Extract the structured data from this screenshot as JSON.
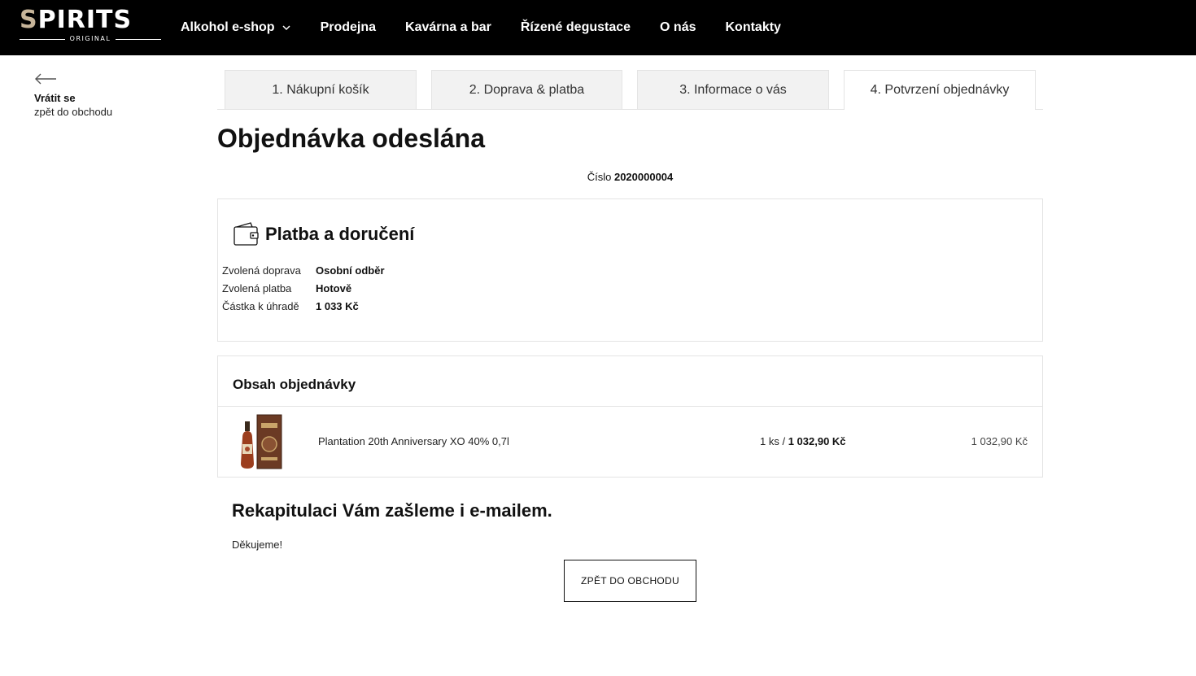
{
  "header": {
    "logo": {
      "text_gold": "S",
      "text_white": "PIRITS",
      "sub": "ORIGINAL"
    },
    "nav": [
      {
        "label": "Alkohol e-shop",
        "has_dropdown": true
      },
      {
        "label": "Prodejna"
      },
      {
        "label": "Kavárna a bar"
      },
      {
        "label": "Řízené degustace"
      },
      {
        "label": "O nás"
      },
      {
        "label": "Kontakty"
      }
    ]
  },
  "back": {
    "title": "Vrátit se",
    "subtitle": "zpět do obchodu"
  },
  "steps": [
    {
      "label": "1. Nákupní košík",
      "active": false
    },
    {
      "label": "2. Doprava & platba",
      "active": false
    },
    {
      "label": "3. Informace o vás",
      "active": false
    },
    {
      "label": "4. Potvrzení objednávky",
      "active": true
    }
  ],
  "page": {
    "title": "Objednávka odeslána",
    "order_label": "Číslo",
    "order_number": "2020000004"
  },
  "payment": {
    "title": "Platba a doručení",
    "icon": "wallet-icon",
    "rows": [
      {
        "label": "Zvolená doprava",
        "value": "Osobní odběr"
      },
      {
        "label": "Zvolená platba",
        "value": "Hotově"
      },
      {
        "label": "Částka k úhradě",
        "value": "1 033 Kč"
      }
    ]
  },
  "contents": {
    "title": "Obsah objednávky",
    "items": [
      {
        "name": "Plantation 20th Anniversary XO 40% 0,7l",
        "qty": "1 ks /",
        "unit_price": "1 032,90 Kč",
        "total": "1 032,90 Kč"
      }
    ]
  },
  "footer": {
    "recap": "Rekapitulaci Vám zašleme i e-mailem.",
    "thanks": "Děkujeme!",
    "button": "ZPĚT DO OBCHODU"
  },
  "colors": {
    "header_bg": "#000000",
    "logo_gold": "#c7b59a",
    "tab_inactive": "#f2f2f2",
    "border": "#e4e4e4"
  }
}
